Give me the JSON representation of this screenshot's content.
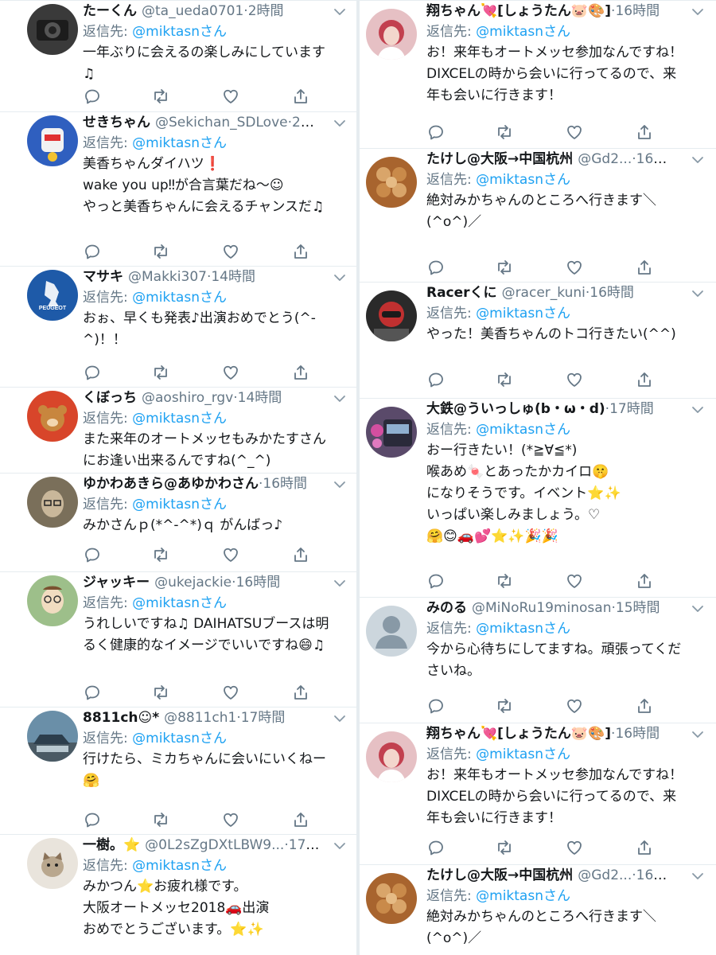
{
  "reply_prefix": "返信先:",
  "colors": {
    "link": "#1da1f2",
    "muted": "#657786",
    "text": "#14171a",
    "border": "#e6ecf0"
  },
  "left": [
    {
      "name": "たーくん",
      "handle": "@ta_ueda0701",
      "time": "2時間",
      "reply_to": "@miktasnさん",
      "body": "一年ぶりに会えるの楽しみにしています\n♫",
      "avatar": "camera-avatar"
    },
    {
      "name": "せきちゃん",
      "handle": "@Sekichan_SDLove",
      "time": "2時間",
      "reply_to": "@miktasnさん",
      "body": "美香ちゃんダイハツ❗\nwake you up‼が合言葉だね〜☺\nやっと美香ちゃんに会えるチャンスだ♫",
      "avatar": "robot-avatar"
    },
    {
      "name": "マサキ",
      "handle": "@Makki307",
      "time": "14時間",
      "reply_to": "@miktasnさん",
      "body": "おぉ、早くも発表♪出演おめでとう(^-\n^)！！",
      "avatar": "peugeot-avatar",
      "avatar_text": "PEUGEOT"
    },
    {
      "name": "くぼっち",
      "handle": "@aoshiro_rgv",
      "time": "14時間",
      "reply_to": "@miktasnさん",
      "body": "また来年のオートメッセもみかたすさん\nにお逢い出来るんですね(^_^)",
      "avatar": "bear-avatar"
    },
    {
      "name": "ゆかわあきら@あゆかわさん",
      "handle": "",
      "time": "16時間",
      "reply_to": "@miktasnさん",
      "body": "みかさんｐ(*^-^*)ｑ がんばっ♪",
      "avatar": "face-avatar"
    },
    {
      "name": "ジャッキー",
      "handle": "@ukejackie",
      "time": "16時間",
      "reply_to": "@miktasnさん",
      "body": "うれしいですね♫ DAIHATSUブースは明\nるく健康的なイメージでいいですね😄♫",
      "avatar": "cartoon-avatar"
    },
    {
      "name": "8811ch☺*",
      "handle": "@8811ch1",
      "time": "17時間",
      "reply_to": "@miktasnさん",
      "body": "行けたら、ミカちゃんに会いにいくねー\n🤗",
      "avatar": "car-avatar"
    },
    {
      "name": "一樹。⭐",
      "handle": "@0L2sZgDXtLBW9...",
      "time": "17時間",
      "reply_to": "@miktasnさん",
      "body": "みかつん⭐お疲れ様です。\n大阪オートメッセ2018🚗出演\nおめでとうございます。⭐✨",
      "avatar": "cat-avatar"
    }
  ],
  "right": [
    {
      "name": "翔ちゃん💘[しょうたん🐷🎨]",
      "handle": "",
      "time": "16時間",
      "reply_to": "@miktasnさん",
      "body": "お！来年もオートメッセ参加なんですね！\nDIXCELの時から会いに行ってるので、来\n年も会いに行きます！",
      "avatar": "girl-avatar"
    },
    {
      "name": "たけし@大阪→中国杭州",
      "handle": "@Gd2...",
      "time": "16時間",
      "reply_to": "@miktasnさん",
      "body": "絶対みかちゃんのところへ行きます＼\n(^o^)／",
      "avatar": "bread-avatar"
    },
    {
      "name": "Racerくに",
      "handle": "@racer_kuni",
      "time": "16時間",
      "reply_to": "@miktasnさん",
      "body": "やった！美香ちゃんのトコ行きたい(^^)",
      "avatar": "helmet-avatar"
    },
    {
      "name": "大鉄@ういっしゅ(b・ω・d)",
      "handle": "",
      "time": "17時間",
      "reply_to": "@miktasnさん",
      "body": "おー行きたい！(*≧∀≦*)\n喉あめ🍬とあったかカイロ🤫\nになりそうです。イベント⭐✨\nいっぱい楽しみましょう。♡\n🤗😊🚗💕⭐✨🎉🎉",
      "avatar": "train-avatar"
    },
    {
      "name": "みのる",
      "handle": "@MiNoRu19minosan",
      "time": "15時間",
      "reply_to": "@miktasnさん",
      "body": "今から心待ちにしてますね。頑張ってくだ\nさいね。",
      "avatar": "default-avatar"
    },
    {
      "name": "翔ちゃん💘[しょうたん🐷🎨]",
      "handle": "",
      "time": "16時間",
      "reply_to": "@miktasnさん",
      "body": "お！来年もオートメッセ参加なんですね！\nDIXCELの時から会いに行ってるので、来\n年も会いに行きます！",
      "avatar": "girl-avatar"
    },
    {
      "name": "たけし@大阪→中国杭州",
      "handle": "@Gd2...",
      "time": "16時間",
      "reply_to": "@miktasnさん",
      "body": "絶対みかちゃんのところへ行きます＼\n(^o^)／",
      "avatar": "bread-avatar"
    }
  ]
}
